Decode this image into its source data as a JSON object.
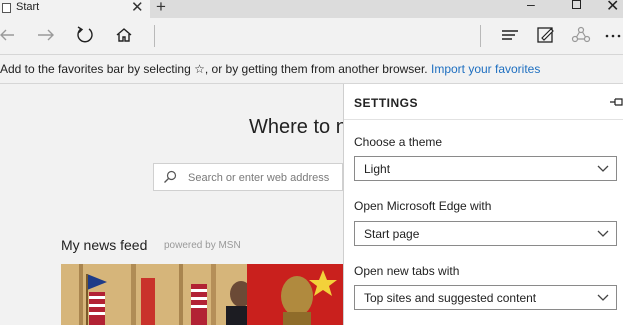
{
  "tab": {
    "title": "Start"
  },
  "favorites_bar": {
    "message": "Add to the favorites bar by selecting ☆, or by getting them from another browser.",
    "link": "Import your favorites"
  },
  "page": {
    "hero_title": "Where to n",
    "search_placeholder": "Search or enter web address",
    "news_feed_title": "My news feed",
    "news_feed_powered": "powered by MSN"
  },
  "settings": {
    "title": "SETTINGS",
    "theme": {
      "label": "Choose a theme",
      "value": "Light"
    },
    "open_with": {
      "label": "Open Microsoft Edge with",
      "value": "Start page"
    },
    "new_tabs": {
      "label": "Open new tabs with",
      "value": "Top sites and suggested content"
    }
  },
  "colors": {
    "link": "#1e6fc0",
    "panel": "#ffffff",
    "chrome": "#f2f2f2"
  }
}
